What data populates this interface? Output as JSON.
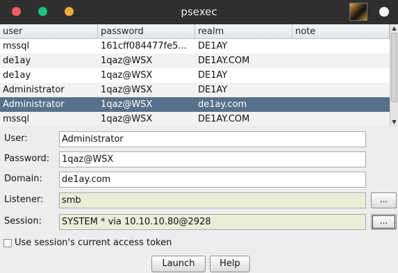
{
  "window": {
    "title": "psexec"
  },
  "table": {
    "headers": [
      "user",
      "password",
      "realm",
      "note"
    ],
    "rows": [
      {
        "user": "mssql",
        "password": "161cff084477fe5...",
        "realm": "DE1AY",
        "note": ""
      },
      {
        "user": "de1ay",
        "password": "1qaz@WSX",
        "realm": "DE1AY.COM",
        "note": ""
      },
      {
        "user": "de1ay",
        "password": "1qaz@WSX",
        "realm": "DE1AY",
        "note": ""
      },
      {
        "user": "Administrator",
        "password": "1qaz@WSX",
        "realm": "DE1AY",
        "note": ""
      },
      {
        "user": "Administrator",
        "password": "1qaz@WSX",
        "realm": "de1ay.com",
        "note": "",
        "selected": true
      },
      {
        "user": "mssql",
        "password": "1qaz@WSX",
        "realm": "DE1AY.COM",
        "note": ""
      }
    ]
  },
  "form": {
    "user_label": "User:",
    "user_value": "Administrator",
    "password_label": "Password:",
    "password_value": "1qaz@WSX",
    "domain_label": "Domain:",
    "domain_value": "de1ay.com",
    "listener_label": "Listener:",
    "listener_value": "smb",
    "session_label": "Session:",
    "session_value": "SYSTEM * via  10.10.10.80@2928",
    "browse_label": "...",
    "token_checkbox_label": "Use session's current access token",
    "token_checked": false
  },
  "buttons": {
    "launch": "Launch",
    "help": "Help"
  },
  "colors": {
    "titlebar": "#2f2f2f",
    "selection": "#587089",
    "close": "#ee5c65",
    "maximize": "#1fc281",
    "minimize": "#f0a93f"
  }
}
